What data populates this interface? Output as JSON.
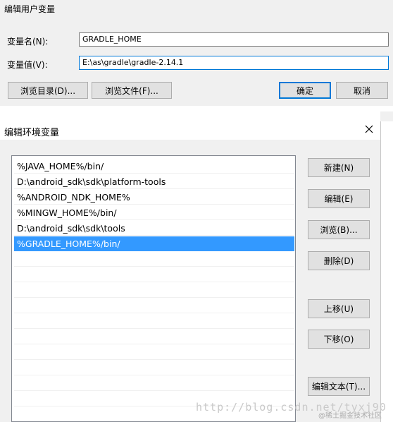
{
  "user_var_dialog": {
    "title": "编辑用户变量",
    "name_label": "变量名(N):",
    "name_value": "GRADLE_HOME",
    "value_label": "变量值(V):",
    "value_value": "E:\\as\\gradle\\gradle-2.14.1",
    "browse_dir_button": "浏览目录(D)...",
    "browse_file_button": "浏览文件(F)...",
    "ok_button": "确定",
    "cancel_button": "取消"
  },
  "env_var_dialog": {
    "title": "编辑环境变量",
    "paths": [
      "%JAVA_HOME%/bin/",
      "D:\\android_sdk\\sdk\\platform-tools",
      "%ANDROID_NDK_HOME%",
      "%MINGW_HOME%/bin/",
      "D:\\android_sdk\\sdk\\tools",
      "%GRADLE_HOME%/bin/"
    ],
    "selected_index": 5,
    "buttons": {
      "new": "新建(N)",
      "edit": "编辑(E)",
      "browse": "浏览(B)...",
      "delete": "删除(D)",
      "move_up": "上移(U)",
      "move_down": "下移(O)",
      "edit_text": "编辑文本(T)..."
    }
  },
  "watermark": {
    "url": "http://blog.csdn.net/tyxj90",
    "credit": "@稀土掘金技术社区"
  },
  "colors": {
    "dialog_bg": "#f0f0f0",
    "selection": "#3399ff",
    "focus_border": "#0078d7"
  }
}
